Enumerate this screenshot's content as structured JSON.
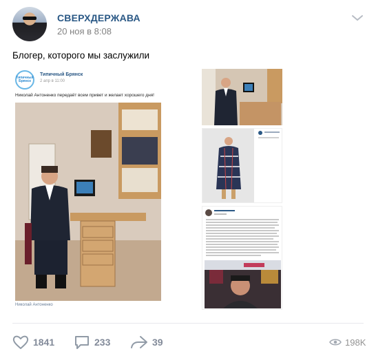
{
  "post": {
    "author": "СВЕРХДЕРЖАВА",
    "date": "20 ноя в 8:08",
    "text": "Блогер, которого мы заслужили"
  },
  "screenshot": {
    "logo_text": "Типичный Брянск",
    "community": "Типичный Брянск",
    "date": "2 апр в 11:00",
    "text": "Николай Антоненко передаёт всем привет и желает хорошего дня!",
    "photo_author": "Николай Антоненко"
  },
  "footer": {
    "likes": "1841",
    "comments": "233",
    "shares": "39",
    "views": "198K"
  },
  "icons": {
    "like": "heart-icon",
    "comment": "comment-icon",
    "share": "share-arrow-icon",
    "views": "eye-icon",
    "menu": "chevron-down-icon"
  },
  "colors": {
    "author_link": "#2a5885",
    "muted": "#828282",
    "action": "#828a99"
  }
}
